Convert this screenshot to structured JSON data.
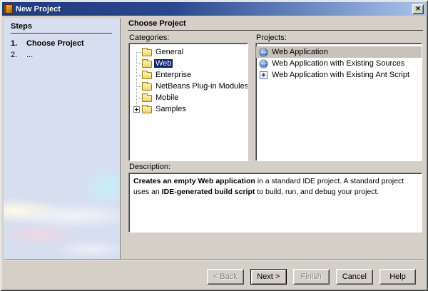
{
  "window": {
    "title": "New Project",
    "close_glyph": "✕"
  },
  "sidebar": {
    "header": "Steps",
    "steps": [
      {
        "number": "1.",
        "label": "Choose Project",
        "current": true
      },
      {
        "number": "2.",
        "label": "...",
        "current": false
      }
    ]
  },
  "content": {
    "header": "Choose Project",
    "categories": {
      "label": "Categories:",
      "items": [
        {
          "label": "General",
          "icon": "folder-icon",
          "selected": false,
          "expander": false
        },
        {
          "label": "Web",
          "icon": "folder-icon",
          "selected": true,
          "expander": false
        },
        {
          "label": "Enterprise",
          "icon": "folder-icon",
          "selected": false,
          "expander": false
        },
        {
          "label": "NetBeans Plug-in Modules",
          "icon": "folder-icon",
          "selected": false,
          "expander": false
        },
        {
          "label": "Mobile",
          "icon": "folder-icon",
          "selected": false,
          "expander": false
        },
        {
          "label": "Samples",
          "icon": "folder-icon",
          "selected": false,
          "expander": true
        }
      ]
    },
    "projects": {
      "label": "Projects:",
      "items": [
        {
          "label": "Web Application",
          "icon": "globe-icon",
          "selected": true
        },
        {
          "label": "Web Application with Existing Sources",
          "icon": "globe-icon",
          "selected": false
        },
        {
          "label": "Web Application with Existing Ant Script",
          "icon": "ant-script-icon",
          "selected": false
        }
      ]
    },
    "description": {
      "label": "Description:",
      "segments": [
        {
          "text": "Creates an empty Web application",
          "bold": true
        },
        {
          "text": " in a standard IDE project. A standard project uses an ",
          "bold": false
        },
        {
          "text": "IDE-generated build script",
          "bold": true
        },
        {
          "text": " to build, run, and debug your project.",
          "bold": false
        }
      ]
    }
  },
  "buttons": [
    {
      "label": "< Back",
      "disabled": true,
      "focused": false
    },
    {
      "label": "Next >",
      "disabled": false,
      "focused": true
    },
    {
      "label": "Finish",
      "disabled": true,
      "focused": false
    },
    {
      "label": "Cancel",
      "disabled": false,
      "focused": false
    },
    {
      "label": "Help",
      "disabled": false,
      "focused": false
    }
  ],
  "icons": {
    "ant_glyph": "✳"
  },
  "colors": {
    "titlebar_gradient_start": "#1f3d7e",
    "titlebar_gradient_end": "#a9c6e8",
    "dialog_bg": "#d4d0c8",
    "sidebar_bg": "#d7def0",
    "tree_selection_bg": "#0a246a",
    "tree_selection_text": "#ffffff",
    "inactive_selection_bg": "#c6c2ba"
  }
}
